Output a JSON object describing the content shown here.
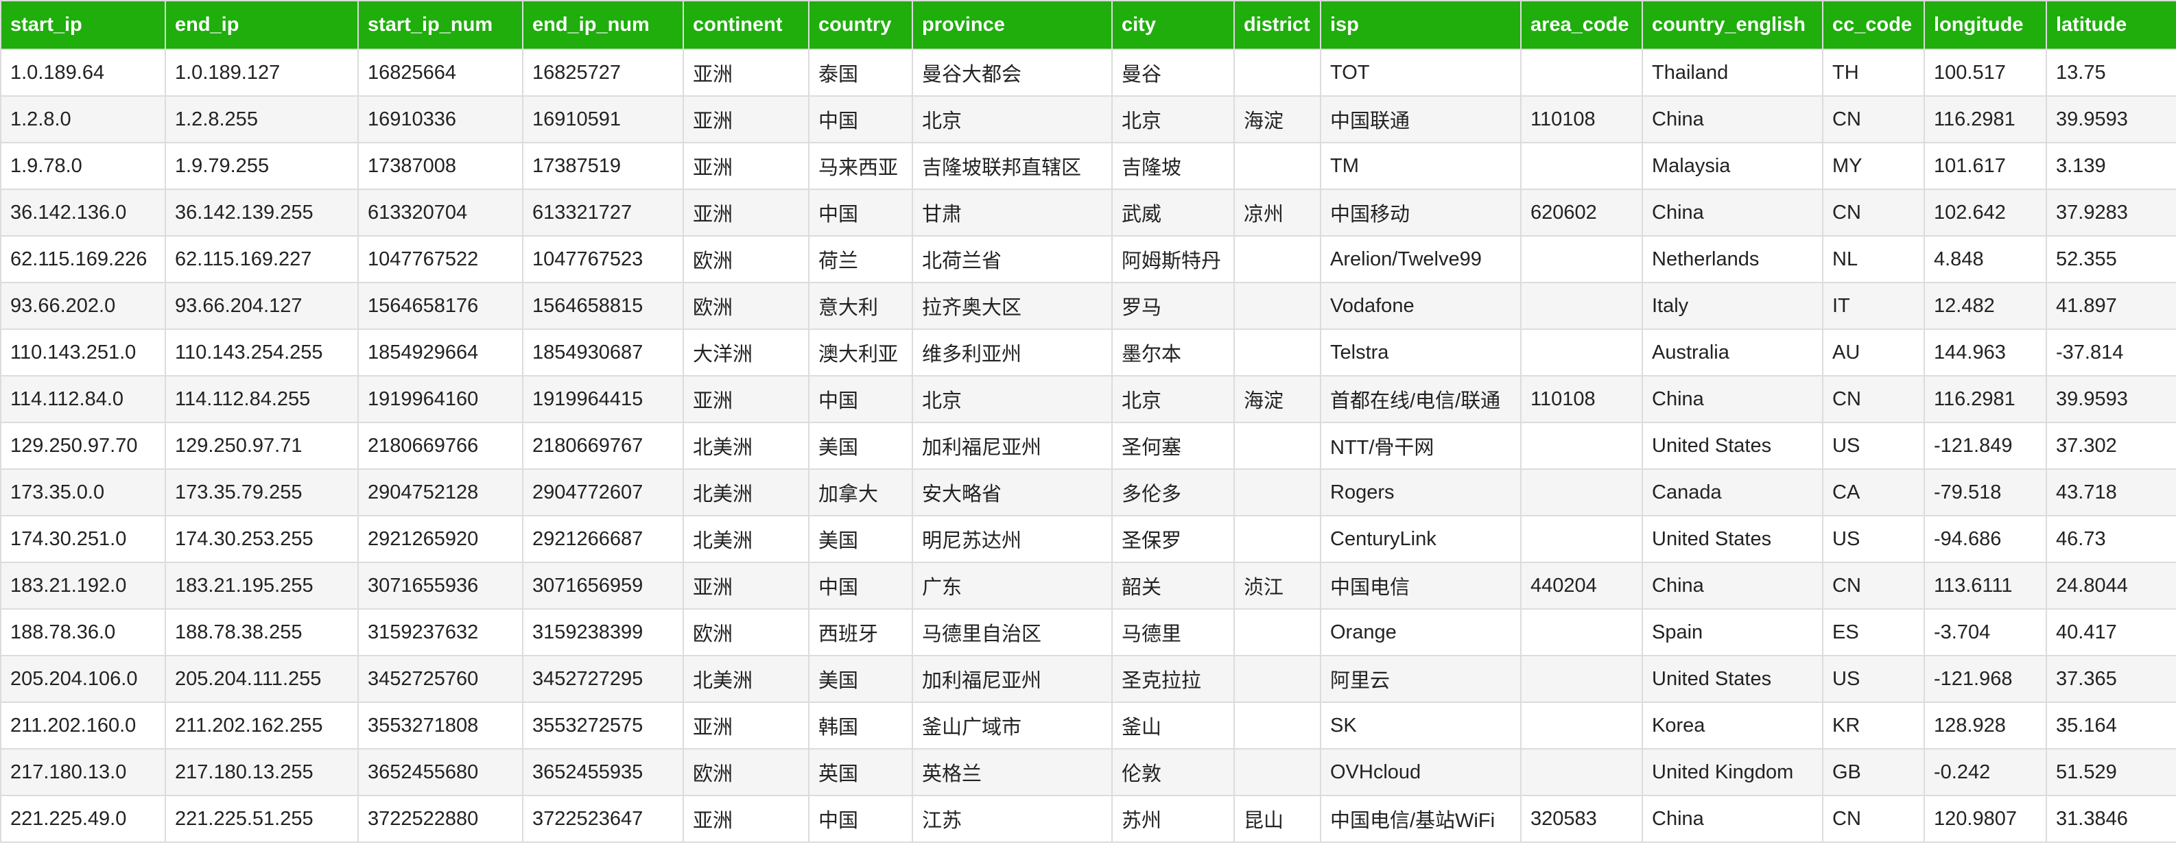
{
  "columns": [
    "start_ip",
    "end_ip",
    "start_ip_num",
    "end_ip_num",
    "continent",
    "country",
    "province",
    "city",
    "district",
    "isp",
    "area_code",
    "country_english",
    "cc_code",
    "longitude",
    "latitude"
  ],
  "rows": [
    [
      "1.0.189.64",
      "1.0.189.127",
      "16825664",
      "16825727",
      "亚洲",
      "泰国",
      "曼谷大都会",
      "曼谷",
      "",
      "TOT",
      "",
      "Thailand",
      "TH",
      "100.517",
      "13.75"
    ],
    [
      "1.2.8.0",
      "1.2.8.255",
      "16910336",
      "16910591",
      "亚洲",
      "中国",
      "北京",
      "北京",
      "海淀",
      "中国联通",
      "110108",
      "China",
      "CN",
      "116.2981",
      "39.9593"
    ],
    [
      "1.9.78.0",
      "1.9.79.255",
      "17387008",
      "17387519",
      "亚洲",
      "马来西亚",
      "吉隆坡联邦直辖区",
      "吉隆坡",
      "",
      "TM",
      "",
      "Malaysia",
      "MY",
      "101.617",
      "3.139"
    ],
    [
      "36.142.136.0",
      "36.142.139.255",
      "613320704",
      "613321727",
      "亚洲",
      "中国",
      "甘肃",
      "武威",
      "凉州",
      "中国移动",
      "620602",
      "China",
      "CN",
      "102.642",
      "37.9283"
    ],
    [
      "62.115.169.226",
      "62.115.169.227",
      "1047767522",
      "1047767523",
      "欧洲",
      "荷兰",
      "北荷兰省",
      "阿姆斯特丹",
      "",
      "Arelion/Twelve99",
      "",
      "Netherlands",
      "NL",
      "4.848",
      "52.355"
    ],
    [
      "93.66.202.0",
      "93.66.204.127",
      "1564658176",
      "1564658815",
      "欧洲",
      "意大利",
      "拉齐奥大区",
      "罗马",
      "",
      "Vodafone",
      "",
      "Italy",
      "IT",
      "12.482",
      "41.897"
    ],
    [
      "110.143.251.0",
      "110.143.254.255",
      "1854929664",
      "1854930687",
      "大洋洲",
      "澳大利亚",
      "维多利亚州",
      "墨尔本",
      "",
      "Telstra",
      "",
      "Australia",
      "AU",
      "144.963",
      "-37.814"
    ],
    [
      "114.112.84.0",
      "114.112.84.255",
      "1919964160",
      "1919964415",
      "亚洲",
      "中国",
      "北京",
      "北京",
      "海淀",
      "首都在线/电信/联通",
      "110108",
      "China",
      "CN",
      "116.2981",
      "39.9593"
    ],
    [
      "129.250.97.70",
      "129.250.97.71",
      "2180669766",
      "2180669767",
      "北美洲",
      "美国",
      "加利福尼亚州",
      "圣何塞",
      "",
      "NTT/骨干网",
      "",
      "United States",
      "US",
      "-121.849",
      "37.302"
    ],
    [
      "173.35.0.0",
      "173.35.79.255",
      "2904752128",
      "2904772607",
      "北美洲",
      "加拿大",
      "安大略省",
      "多伦多",
      "",
      "Rogers",
      "",
      "Canada",
      "CA",
      "-79.518",
      "43.718"
    ],
    [
      "174.30.251.0",
      "174.30.253.255",
      "2921265920",
      "2921266687",
      "北美洲",
      "美国",
      "明尼苏达州",
      "圣保罗",
      "",
      "CenturyLink",
      "",
      "United States",
      "US",
      "-94.686",
      "46.73"
    ],
    [
      "183.21.192.0",
      "183.21.195.255",
      "3071655936",
      "3071656959",
      "亚洲",
      "中国",
      "广东",
      "韶关",
      "浈江",
      "中国电信",
      "440204",
      "China",
      "CN",
      "113.6111",
      "24.8044"
    ],
    [
      "188.78.36.0",
      "188.78.38.255",
      "3159237632",
      "3159238399",
      "欧洲",
      "西班牙",
      "马德里自治区",
      "马德里",
      "",
      "Orange",
      "",
      "Spain",
      "ES",
      "-3.704",
      "40.417"
    ],
    [
      "205.204.106.0",
      "205.204.111.255",
      "3452725760",
      "3452727295",
      "北美洲",
      "美国",
      "加利福尼亚州",
      "圣克拉拉",
      "",
      "阿里云",
      "",
      "United States",
      "US",
      "-121.968",
      "37.365"
    ],
    [
      "211.202.160.0",
      "211.202.162.255",
      "3553271808",
      "3553272575",
      "亚洲",
      "韩国",
      "釜山广域市",
      "釜山",
      "",
      "SK",
      "",
      "Korea",
      "KR",
      "128.928",
      "35.164"
    ],
    [
      "217.180.13.0",
      "217.180.13.255",
      "3652455680",
      "3652455935",
      "欧洲",
      "英国",
      "英格兰",
      "伦敦",
      "",
      "OVHcloud",
      "",
      "United Kingdom",
      "GB",
      "-0.242",
      "51.529"
    ],
    [
      "221.225.49.0",
      "221.225.51.255",
      "3722522880",
      "3722523647",
      "亚洲",
      "中国",
      "江苏",
      "苏州",
      "昆山",
      "中国电信/基站WiFi",
      "320583",
      "China",
      "CN",
      "120.9807",
      "31.3846"
    ]
  ]
}
